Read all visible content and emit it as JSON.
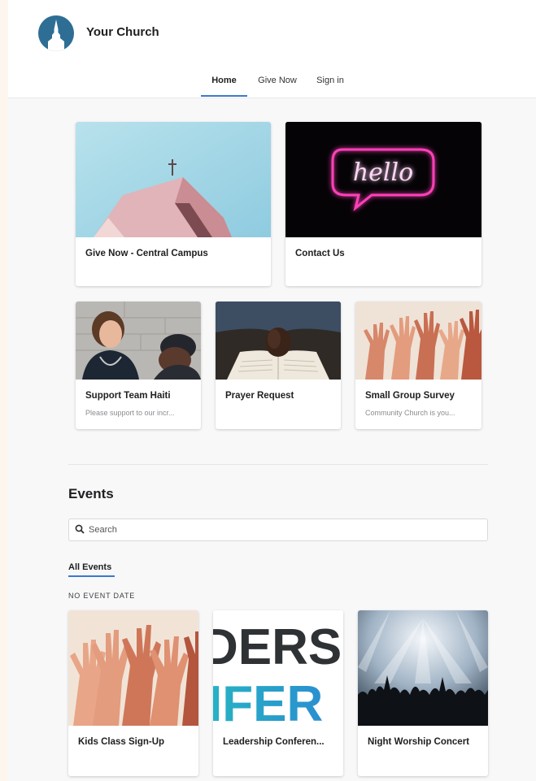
{
  "header": {
    "brand": "Your Church",
    "nav": [
      {
        "label": "Home",
        "active": true
      },
      {
        "label": "Give Now",
        "active": false
      },
      {
        "label": "Sign in",
        "active": false
      }
    ]
  },
  "featured": [
    {
      "title": "Give Now - Central Campus",
      "description": ""
    },
    {
      "title": "Contact Us",
      "description": ""
    }
  ],
  "cards": [
    {
      "title": "Support Team Haiti",
      "description": "Please support to our incr..."
    },
    {
      "title": "Prayer Request",
      "description": ""
    },
    {
      "title": "Small Group Survey",
      "description": "Community Church is you..."
    }
  ],
  "neon_text": "hello",
  "events": {
    "heading": "Events",
    "search_placeholder": "Search",
    "tab": "All Events",
    "date_group": "NO EVENT DATE",
    "items": [
      {
        "title": "Kids Class Sign-Up"
      },
      {
        "title": "Leadership Conferen..."
      },
      {
        "title": "Night Worship Concert"
      }
    ],
    "leadership_art_lines": [
      "DERS",
      "IFER"
    ]
  },
  "colors": {
    "accent": "#3d79c9",
    "logo": "#2e6e95",
    "neon": "#ff3fb8"
  }
}
